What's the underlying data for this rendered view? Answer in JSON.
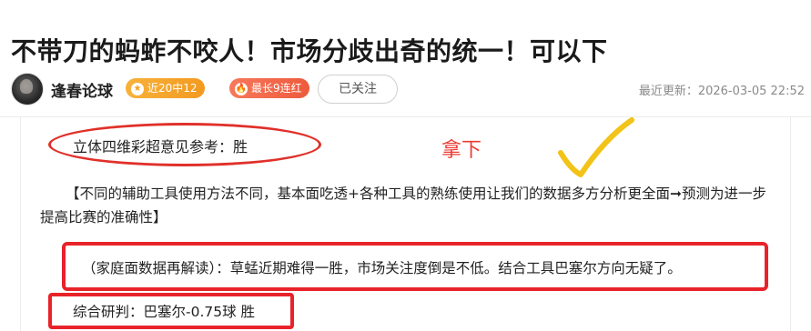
{
  "article": {
    "title": "不带刀的蚂蚱不咬人！市场分歧出奇的统一！可以下"
  },
  "author": {
    "name": "逢春论球",
    "badge_recent": "近20中12",
    "badge_streak": "最长9连红",
    "follow_label": "已关注",
    "update_time": "最近更新：2026-03-05 22:52"
  },
  "content": {
    "line1": "立体四维彩超意见参考：胜",
    "handwritten_note": "拿下",
    "paragraph": "【不同的辅助工具使用方法不同，基本面吃透+各种工具的熟练使用让我们的数据多方分析更全面➞预测为进一步提高比赛的准确性】",
    "analysis": "（家庭面数据再解读）：草蜢近期难得一胜，市场关注度倒是不低。结合工具巴塞尔方向无疑了。",
    "verdict": "综合研判：巴塞尔-0.75球  胜"
  },
  "colors": {
    "annotation_red": "#e8232a",
    "checkmark_yellow": "#f2c318",
    "badge_orange": "#f3a127",
    "badge_red": "#ee5a3c"
  },
  "icons": {
    "star": "star-icon",
    "fire": "fire-icon",
    "check": "checkmark-annotation"
  }
}
